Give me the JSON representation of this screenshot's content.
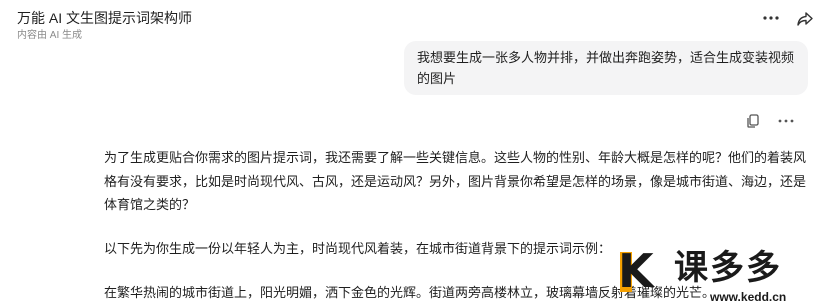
{
  "header": {
    "title": "万能 AI 文生图提示词架构师",
    "subtitle": "内容由 AI 生成",
    "more_icon": "more-horizontal-icon",
    "share_icon": "share-arrow-icon"
  },
  "user_message": {
    "text": "我想要生成一张多人物并排，并做出奔跑姿势，适合生成变装视频的图片"
  },
  "message_actions": {
    "copy_icon": "copy-icon",
    "more_icon": "more-horizontal-icon"
  },
  "assistant_message": {
    "paragraph1": "为了生成更贴合你需求的图片提示词，我还需要了解一些关键信息。这些人物的性别、年龄大概是怎样的呢？他们的着装风格有没有要求，比如是时尚现代风、古风，还是运动风？另外，图片背景你希望是怎样的场景，像是城市街道、海边，还是体育馆之类的？",
    "paragraph2": "以下先为你生成一份以年轻人为主，时尚现代风着装，在城市街道背景下的提示词示例：",
    "paragraph3": "在繁华热闹的城市街道上，阳光明媚，洒下金色的光辉。街道两旁高楼林立，玻璃幕墙反射着璀璨的光芒。"
  },
  "watermark": {
    "logo_letter": "K",
    "brand": "课多多",
    "url": "www.kedd.cn",
    "accent": "#f5a000"
  }
}
